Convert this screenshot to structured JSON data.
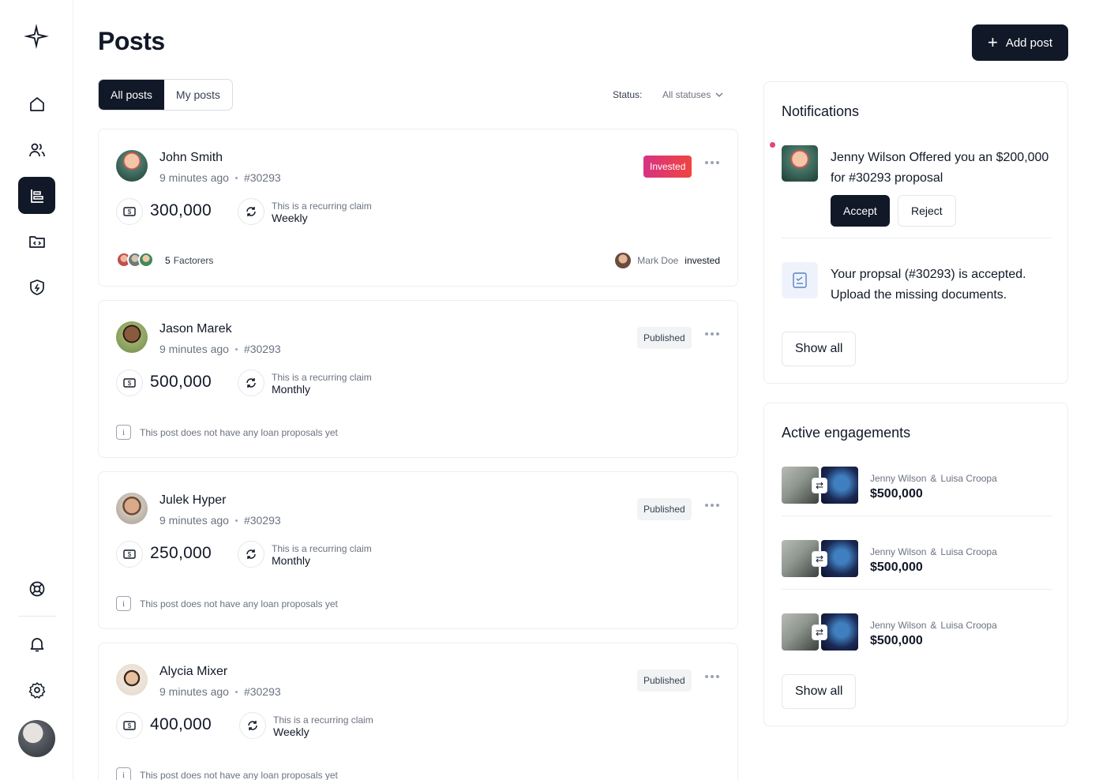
{
  "page": {
    "title": "Posts",
    "add_post_label": "Add post"
  },
  "tabs": [
    {
      "label": "All posts",
      "active": true
    },
    {
      "label": "My posts",
      "active": false
    }
  ],
  "status_filter": {
    "label": "Status:",
    "value": "All statuses"
  },
  "posts": [
    {
      "name": "John Smith",
      "time": "9 minutes ago",
      "id": "#30293",
      "badge": "Invested",
      "amount": "300,000",
      "recurring_text": "This is a recurring claim",
      "frequency": "Weekly",
      "factorers_count": "5",
      "factorers_label": "Factorers",
      "investor_name": "Mark Doe",
      "investor_action": "invested"
    },
    {
      "name": "Jason Marek",
      "time": "9 minutes ago",
      "id": "#30293",
      "badge": "Published",
      "amount": "500,000",
      "recurring_text": "This is a recurring claim",
      "frequency": "Monthly",
      "note": "This post does not have any loan proposals yet"
    },
    {
      "name": "Julek Hyper",
      "time": "9 minutes ago",
      "id": "#30293",
      "badge": "Published",
      "amount": "250,000",
      "recurring_text": "This is a recurring claim",
      "frequency": "Monthly",
      "note": "This post does not have any loan proposals yet"
    },
    {
      "name": "Alycia Mixer",
      "time": "9 minutes ago",
      "id": "#30293",
      "badge": "Published",
      "amount": "400,000",
      "recurring_text": "This is a recurring claim",
      "frequency": "Weekly",
      "note": "This post does not have any loan proposals yet"
    }
  ],
  "notifications": {
    "title": "Notifications",
    "items": [
      {
        "text": "Jenny Wilson Offered you an $200,000 for #30293 proposal",
        "accept": "Accept",
        "reject": "Reject"
      },
      {
        "text": "Your propsal (#30293) is accepted. Upload the missing documents."
      }
    ],
    "show_all": "Show all"
  },
  "engagements": {
    "title": "Active engagements",
    "items": [
      {
        "person_a": "Jenny Wilson",
        "amp": "&",
        "person_b": "Luisa Croopa",
        "amount": "$500,000"
      },
      {
        "person_a": "Jenny Wilson",
        "amp": "&",
        "person_b": "Luisa Croopa",
        "amount": "$500,000"
      },
      {
        "person_a": "Jenny Wilson",
        "amp": "&",
        "person_b": "Luisa Croopa",
        "amount": "$500,000"
      }
    ],
    "show_all": "Show all"
  },
  "colors": {
    "primary": "#111827",
    "invested_gradient_start": "#d63384",
    "invested_gradient_end": "#f0453f",
    "notification_dot": "#e0457b"
  },
  "icons": [
    "logo-icon",
    "home-icon",
    "users-icon",
    "posts-icon",
    "folder-code-icon",
    "shield-icon",
    "support-icon",
    "bell-icon",
    "settings-icon"
  ]
}
